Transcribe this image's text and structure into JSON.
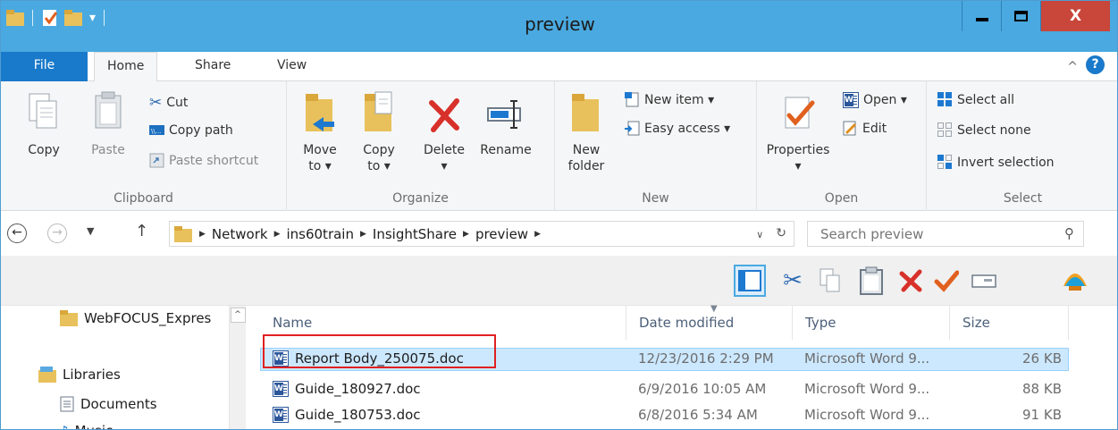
{
  "window": {
    "title": "preview"
  },
  "ribbon_tabs": {
    "file": "File",
    "home": "Home",
    "share": "Share",
    "view": "View"
  },
  "clipboard": {
    "copy": "Copy",
    "paste": "Paste",
    "cut": "Cut",
    "copy_path": "Copy path",
    "paste_shortcut": "Paste shortcut",
    "label": "Clipboard"
  },
  "organize": {
    "move_to": "Move",
    "move_to_2": "to ▾",
    "copy_to": "Copy",
    "copy_to_2": "to ▾",
    "delete": "Delete",
    "delete_2": "▾",
    "rename": "Rename",
    "label": "Organize"
  },
  "new_group": {
    "new_folder": "New",
    "new_folder_2": "folder",
    "new_item": "New item ▾",
    "easy_access": "Easy access ▾",
    "label": "New"
  },
  "open_group": {
    "properties": "Properties",
    "properties_2": "▾",
    "open": "Open ▾",
    "edit": "Edit",
    "label": "Open"
  },
  "select_group": {
    "select_all": "Select all",
    "select_none": "Select none",
    "invert_selection": "Invert selection",
    "label": "Select"
  },
  "address": {
    "crumbs": [
      "Network",
      "ins60train",
      "InsightShare",
      "preview"
    ],
    "search_placeholder": "Search preview"
  },
  "nav_pane": {
    "items": [
      "WebFOCUS_Expres",
      "Libraries",
      "Documents",
      "Music"
    ]
  },
  "columns": {
    "name": "Name",
    "date": "Date modified",
    "type": "Type",
    "size": "Size"
  },
  "files": [
    {
      "name": "Report Body_250075.doc",
      "date": "12/23/2016 2:29 PM",
      "type": "Microsoft Word 9...",
      "size": "26 KB"
    },
    {
      "name": "Guide_180927.doc",
      "date": "6/9/2016 10:05 AM",
      "type": "Microsoft Word 9...",
      "size": "88 KB"
    },
    {
      "name": "Guide_180753.doc",
      "date": "6/8/2016 5:34 AM",
      "type": "Microsoft Word 9...",
      "size": "91 KB"
    }
  ],
  "colors": {
    "titlebar": "#4aa9e0",
    "file_tab": "#1979ca",
    "close_button": "#c8463a",
    "selection": "#cce8ff",
    "annotation_box": "#e02020"
  }
}
